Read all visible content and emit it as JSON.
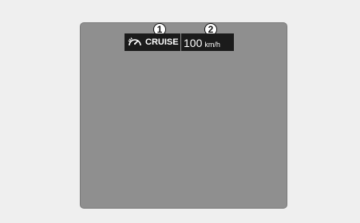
{
  "display": {
    "callouts": [
      "1",
      "2"
    ],
    "cruise": {
      "icon": "cruise-control-speedometer-icon",
      "label": "CRUISE"
    },
    "speed": {
      "value": "100",
      "unit": "km/h"
    }
  },
  "colors": {
    "background": "#efefef",
    "screen": "#8f8f8f",
    "indicator_bg": "#1b1b1b",
    "indicator_text": "#ffffff"
  }
}
